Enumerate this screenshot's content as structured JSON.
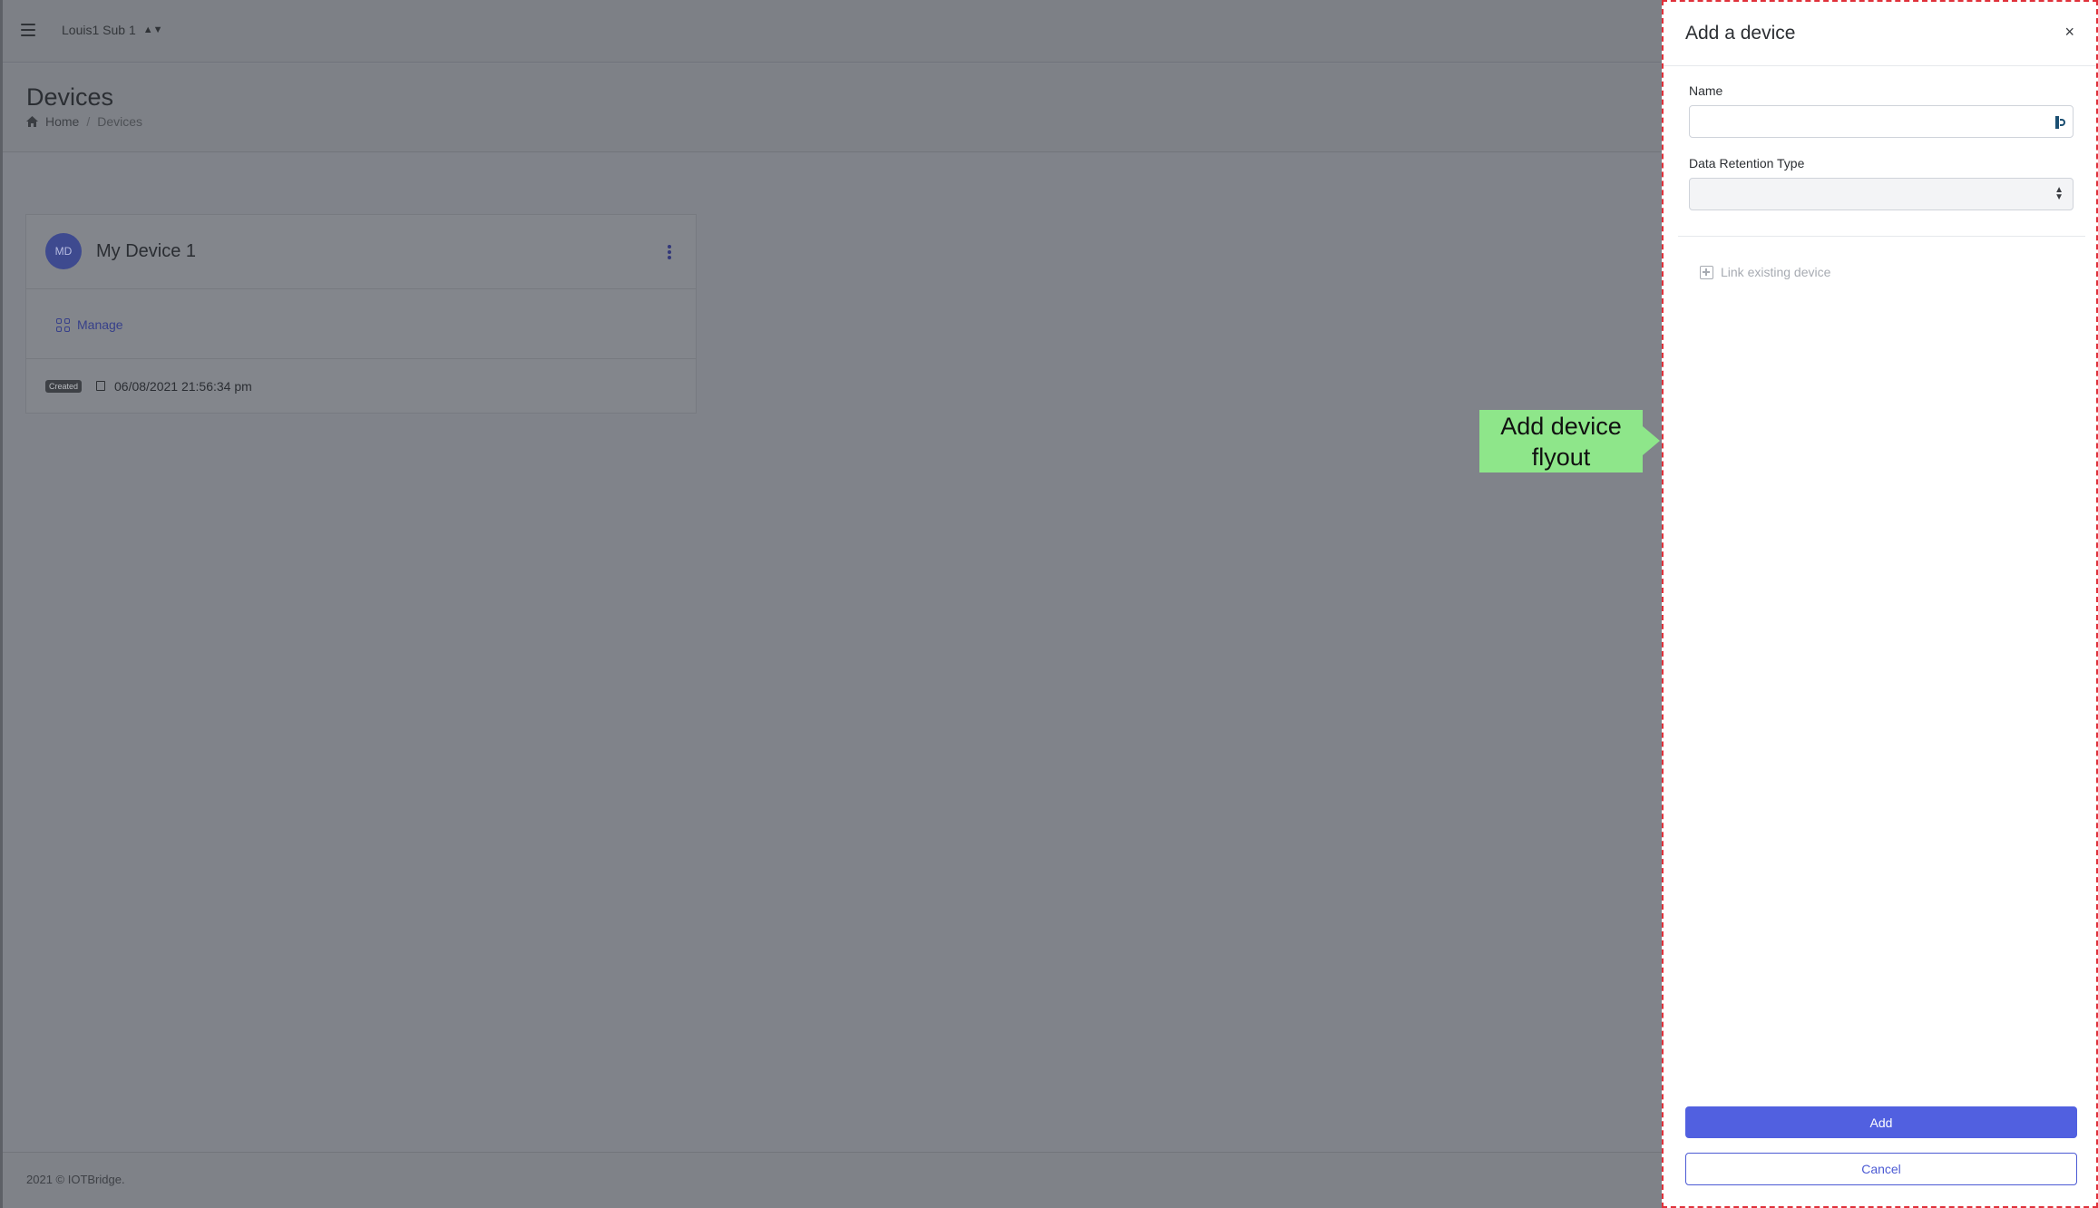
{
  "topbar": {
    "org_name": "Louis1 Sub 1",
    "menu_icon": "hamburger-menu-icon",
    "org_switch_icon": "up-down-arrows-icon"
  },
  "page": {
    "title": "Devices",
    "breadcrumb": {
      "home_label": "Home",
      "current_label": "Devices",
      "home_icon": "home-icon"
    }
  },
  "device_card": {
    "avatar_initials": "MD",
    "name": "My Device 1",
    "manage_label": "Manage",
    "created_badge": "Created",
    "created_date": "06/08/2021 21:56:34 pm"
  },
  "footer": {
    "copyright": "2021 © IOTBridge."
  },
  "callout": {
    "text_line1": "Add device",
    "text_line2": "flyout",
    "color": "#8ee68a"
  },
  "flyout": {
    "title": "Add a device",
    "close_icon": "×",
    "name_label": "Name",
    "name_value": "",
    "retention_label": "Data Retention Type",
    "retention_value": "",
    "link_existing_label": "Link existing device",
    "add_label": "Add",
    "cancel_label": "Cancel",
    "accent_color": "#5160e0",
    "border_color": "#e0303a"
  }
}
